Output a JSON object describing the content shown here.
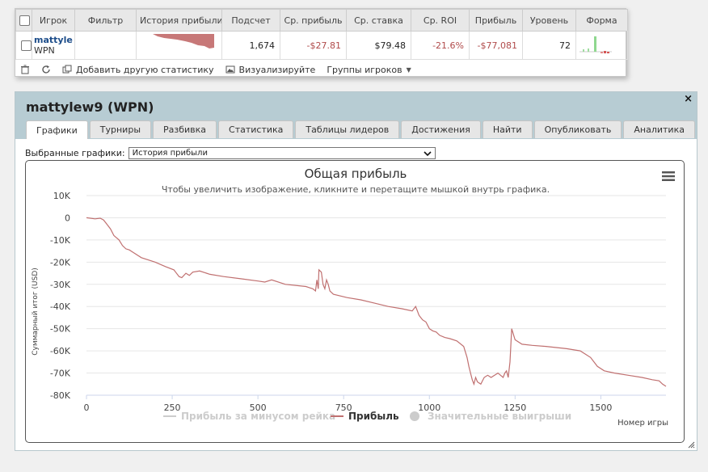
{
  "stats_table": {
    "headers": [
      "Игрок",
      "Фильтр",
      "История прибыли",
      "Подсчет",
      "Ср. прибыль",
      "Ср. ставка",
      "Ср. ROI",
      "Прибыль",
      "Уровень",
      "Форма"
    ],
    "row": {
      "player": "mattylew9",
      "site": "WPN",
      "count": "1,674",
      "avg_profit": "-$27.81",
      "avg_stake": "$79.48",
      "avg_roi": "-21.6%",
      "profit": "-$77,081",
      "level": "72",
      "remove": "x"
    },
    "toolbar": {
      "add_stats": "Добавить другую статистику",
      "visualize": "Визуализируйте",
      "groups": "Группы игроков"
    }
  },
  "window": {
    "title": "mattylew9 (WPN)",
    "close": "×",
    "tabs": [
      "Графики",
      "Турниры",
      "Разбивка",
      "Статистика",
      "Таблицы лидеров",
      "Достижения",
      "Найти",
      "Опубликовать",
      "Аналитика"
    ],
    "active_tab": "Графики",
    "select_label": "Выбранные графики:",
    "select_value": "История прибыли"
  },
  "chart_data": {
    "type": "line",
    "title": "Общая прибыль",
    "subtitle": "Чтобы увеличить изображение, кликните и перетащите мышкой внутрь графика.",
    "ylabel": "Суммарный итог (USD)",
    "xlabel": "Номер игры",
    "xlim": [
      0,
      1690
    ],
    "ylim": [
      -80000,
      10000
    ],
    "x_ticks": [
      0,
      250,
      500,
      750,
      1000,
      1250,
      1500
    ],
    "y_ticks": [
      10000,
      0,
      -10000,
      -20000,
      -30000,
      -40000,
      -50000,
      -60000,
      -70000,
      -80000
    ],
    "y_tick_labels": [
      "10K",
      "0",
      "-10K",
      "-20K",
      "-30K",
      "-40K",
      "-50K",
      "-60K",
      "-70K",
      "-80K"
    ],
    "colors": {
      "profit": "#c07070",
      "legend_inactive": "#cccccc"
    },
    "legend": [
      {
        "name": "Прибыль за минусом рейка",
        "active": false
      },
      {
        "name": "Прибыль",
        "active": true
      },
      {
        "name": "Значительные выигрыши",
        "active": false
      }
    ],
    "series": [
      {
        "name": "Прибыль",
        "x": [
          0,
          25,
          40,
          50,
          60,
          70,
          80,
          95,
          105,
          115,
          125,
          135,
          160,
          180,
          200,
          230,
          255,
          260,
          270,
          278,
          290,
          300,
          310,
          330,
          360,
          400,
          450,
          500,
          520,
          540,
          580,
          640,
          660,
          668,
          672,
          676,
          678,
          685,
          690,
          695,
          700,
          705,
          710,
          720,
          760,
          800,
          840,
          880,
          920,
          950,
          960,
          970,
          980,
          990,
          1000,
          1010,
          1020,
          1030,
          1045,
          1060,
          1080,
          1100,
          1110,
          1115,
          1120,
          1125,
          1130,
          1135,
          1140,
          1150,
          1160,
          1170,
          1180,
          1200,
          1215,
          1220,
          1225,
          1230,
          1235,
          1240,
          1250,
          1270,
          1300,
          1340,
          1400,
          1440,
          1470,
          1490,
          1510,
          1540,
          1580,
          1620,
          1650,
          1670,
          1680,
          1690
        ],
        "y": [
          0,
          -500,
          -200,
          -1000,
          -3000,
          -5000,
          -8000,
          -10000,
          -12500,
          -14000,
          -14500,
          -15500,
          -18000,
          -19000,
          -20000,
          -22000,
          -23500,
          -24500,
          -26500,
          -27000,
          -25000,
          -26000,
          -24500,
          -24000,
          -25500,
          -26500,
          -27500,
          -28500,
          -29000,
          -28000,
          -30000,
          -31000,
          -32000,
          -33000,
          -28000,
          -32000,
          -23500,
          -24500,
          -30000,
          -32000,
          -28000,
          -30000,
          -33000,
          -34500,
          -36000,
          -37000,
          -38500,
          -40000,
          -41000,
          -42000,
          -40000,
          -44000,
          -46000,
          -47000,
          -50000,
          -51000,
          -51500,
          -53000,
          -54000,
          -54500,
          -55500,
          -58000,
          -63000,
          -67000,
          -70000,
          -73000,
          -75000,
          -72000,
          -74000,
          -75000,
          -72000,
          -71000,
          -72000,
          -70000,
          -72000,
          -70000,
          -69000,
          -72000,
          -65000,
          -50000,
          -55000,
          -57000,
          -57500,
          -58000,
          -59000,
          -60000,
          -63000,
          -67000,
          -69000,
          -70000,
          -71000,
          -72000,
          -73000,
          -73500,
          -75000,
          -76000
        ]
      }
    ]
  }
}
